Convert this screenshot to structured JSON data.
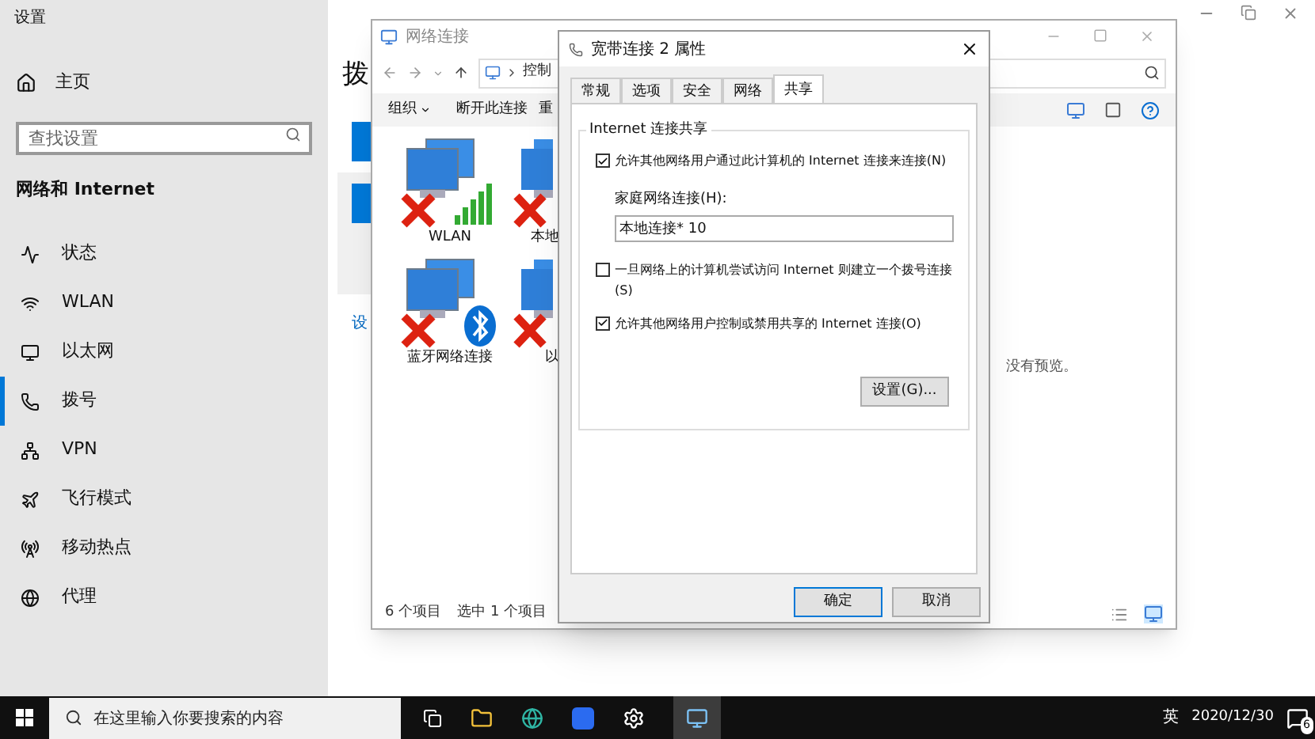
{
  "settings": {
    "title": "设置",
    "home": "主页",
    "search": {
      "placeholder": "查找设置"
    },
    "section": "网络和 Internet",
    "nav": [
      {
        "label": "状态",
        "selected": false
      },
      {
        "label": "WLAN",
        "selected": false
      },
      {
        "label": "以太网",
        "selected": false
      },
      {
        "label": "拨号",
        "selected": true
      },
      {
        "label": "VPN",
        "selected": false
      },
      {
        "label": "飞行模式",
        "selected": false
      },
      {
        "label": "移动热点",
        "selected": false
      },
      {
        "label": "代理",
        "selected": false
      }
    ],
    "heading": "拨",
    "link": "设"
  },
  "explorer": {
    "title": "网络连接",
    "breadcrumb": "控制",
    "toolbar": [
      "组织",
      "断开此连接",
      "重"
    ],
    "items": [
      {
        "label": "WLAN",
        "kind": "wifi"
      },
      {
        "label": "本地",
        "kind": "plain"
      },
      {
        "label": "蓝牙网络连接",
        "kind": "bluetooth"
      },
      {
        "label": "以",
        "kind": "plain"
      }
    ],
    "preview": "没有预览。",
    "status": [
      "6 个项目",
      "选中 1 个项目"
    ]
  },
  "dialog": {
    "title": "宽带连接 2 属性",
    "tabs": [
      {
        "label": "常规",
        "selected": false
      },
      {
        "label": "选项",
        "selected": false
      },
      {
        "label": "安全",
        "selected": false
      },
      {
        "label": "网络",
        "selected": false
      },
      {
        "label": "共享",
        "selected": true
      }
    ],
    "group": "Internet 连接共享",
    "options": [
      {
        "label": "允许其他网络用户通过此计算机的 Internet 连接来连接(N)",
        "checked": true
      },
      {
        "label": "一旦网络上的计算机尝试访问 Internet 则建立一个拨号连接(S)",
        "checked": false
      },
      {
        "label": "允许其他网络用户控制或禁用共享的 Internet 连接(O)",
        "checked": true
      }
    ],
    "home_label": "家庭网络连接(H):",
    "home_value": "本地连接* 10",
    "settings_button": "设置(G)...",
    "ok": "确定",
    "cancel": "取消"
  },
  "taskbar": {
    "search": {
      "placeholder": "在这里输入你要搜索的内容"
    },
    "ime": "英",
    "date": "2020/12/30",
    "notifications": "6"
  }
}
